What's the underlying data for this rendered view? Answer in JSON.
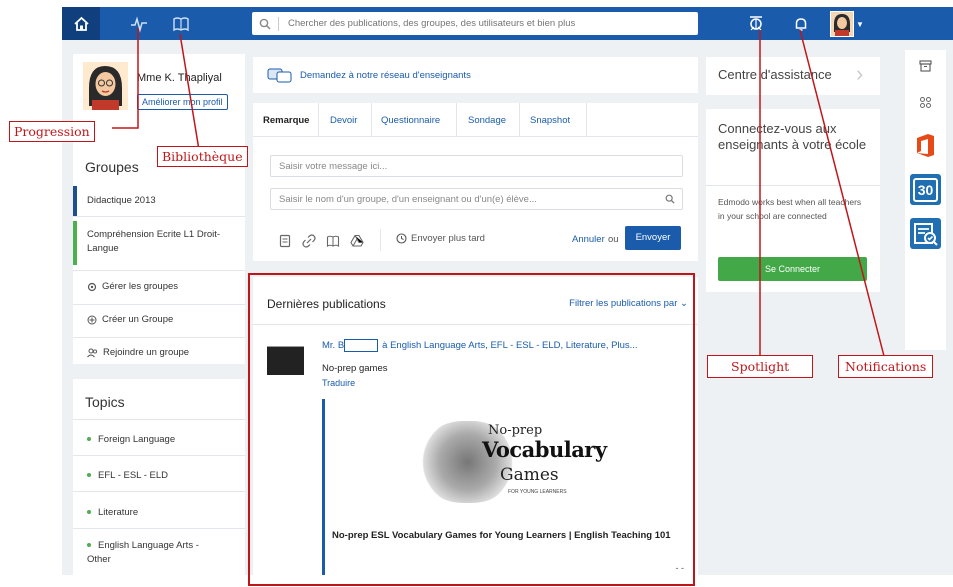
{
  "search": {
    "placeholder": "Chercher des publications, des groupes, des utilisateurs et bien plus"
  },
  "profile": {
    "name": "Mme K. Thapliyal",
    "improve_label": "Améliorer mon profil"
  },
  "groups": {
    "title": "Groupes",
    "items": [
      {
        "label": "Didactique 2013",
        "color": "#1d4f91"
      },
      {
        "label": "Compréhension Ecrite L1 Droit-Langue",
        "color": "#4caf50"
      }
    ],
    "actions": {
      "manage": "Gérer les groupes",
      "create": "Créer un Groupe",
      "join": "Rejoindre un groupe"
    }
  },
  "topics": {
    "title": "Topics",
    "items": [
      "Foreign Language",
      "EFL - ESL - ELD",
      "Literature",
      "English Language Arts - Other"
    ]
  },
  "ask_network": "Demandez à notre réseau d'enseignants",
  "composer": {
    "tabs": [
      "Remarque",
      "Devoir",
      "Questionnaire",
      "Sondage",
      "Snapshot"
    ],
    "message_placeholder": "Saisir votre message ici...",
    "recipient_placeholder": "Saisir le nom d'un groupe, d'un enseignant ou d'un(e) élève...",
    "send_later": "Envoyer plus tard",
    "cancel": "Annuler",
    "or": "ou",
    "send": "Envoyer"
  },
  "feed": {
    "heading": "Dernières publications",
    "filter": "Filtrer les publications par",
    "post": {
      "author_prefix": "Mr. B",
      "target": "à English Language Arts, EFL - ESL - ELD, Literature, Plus...",
      "text": "No-prep games",
      "translate": "Traduire",
      "image_line1": "No-prep",
      "image_line2": "Vocabulary",
      "image_line3": "Games",
      "image_line4": "FOR YOUNG LEARNERS",
      "title": "No-prep ESL Vocabulary Games for Young Learners | English Teaching 101",
      "more": "- -"
    }
  },
  "help": {
    "title": "Centre d'assistance"
  },
  "connect": {
    "title": "Connectez-vous aux enseignants à votre école",
    "desc": "Edmodo works best when all teachers in your school are connected",
    "button": "Se Connecter"
  },
  "rail": {
    "calendar_day": "30"
  },
  "annotations": {
    "progression": "Progression",
    "bibliotheque": "Bibliothèque",
    "spotlight": "Spotlight",
    "notifications": "Notifications"
  },
  "colors": {
    "brand_blue": "#1a5cab",
    "annotation_red": "#c0161a",
    "connect_green": "#43a948"
  }
}
